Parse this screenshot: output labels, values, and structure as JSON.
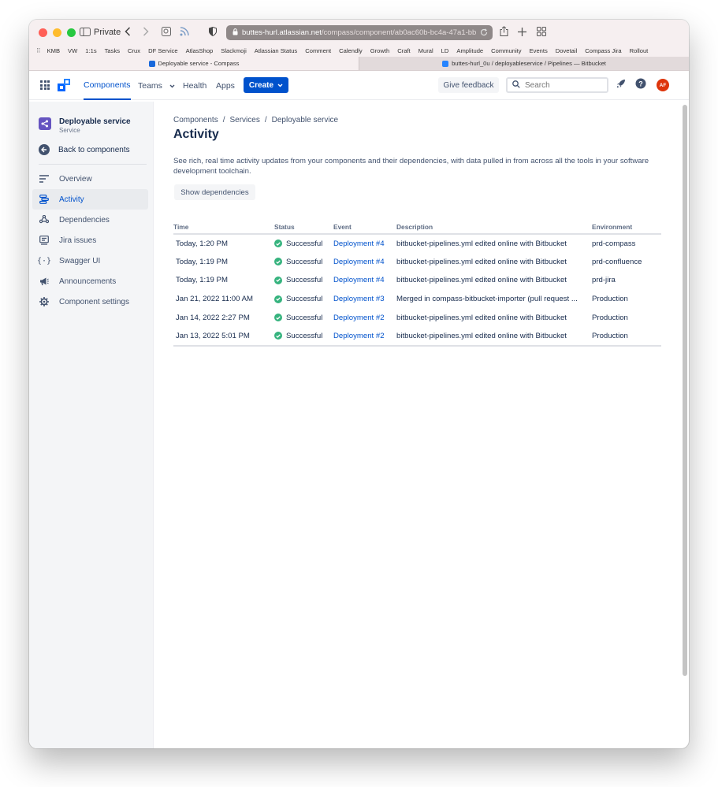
{
  "browser": {
    "private_label": "Private",
    "url_host": "buttes-hurl.atlassian.net",
    "url_path": "/compass/component/ab0ac60b-bc4a-47a1-bb",
    "bookmarks": [
      "KMB",
      "VW",
      "1:1s",
      "Tasks",
      "Crux",
      "DF Service",
      "AtlasShop",
      "Slackmoji",
      "Atlassian Status",
      "Comment",
      "Calendly",
      "Growth",
      "Craft",
      "Mural",
      "LD",
      "Amplitude",
      "Community",
      "Events",
      "Dovetail",
      "Compass Jira",
      "Rollout"
    ],
    "tabs": [
      {
        "title": "Deployable service - Compass",
        "active": true
      },
      {
        "title": "buttes-hurl_0u / deployableservice / Pipelines — Bitbucket",
        "active": false
      }
    ],
    "traffic_colors": [
      "#ff5f57",
      "#febc2e",
      "#28c840"
    ]
  },
  "header": {
    "nav": [
      "Components",
      "Teams",
      "Health",
      "Apps"
    ],
    "create_label": "Create",
    "feedback_label": "Give feedback",
    "search_placeholder": "Search",
    "avatar_initials": "AF",
    "accent": "#0052cc"
  },
  "sidebar": {
    "component_name": "Deployable service",
    "component_type": "Service",
    "back_label": "Back to components",
    "items": [
      {
        "label": "Overview",
        "icon": "overview-icon"
      },
      {
        "label": "Activity",
        "icon": "activity-icon",
        "active": true
      },
      {
        "label": "Dependencies",
        "icon": "dependencies-icon"
      },
      {
        "label": "Jira issues",
        "icon": "jira-issues-icon"
      },
      {
        "label": "Swagger UI",
        "icon": "swagger-icon"
      },
      {
        "label": "Announcements",
        "icon": "megaphone-icon"
      },
      {
        "label": "Component settings",
        "icon": "gear-icon"
      }
    ]
  },
  "main": {
    "breadcrumb": [
      "Components",
      "Services",
      "Deployable service"
    ],
    "title": "Activity",
    "description": "See rich, real time activity updates from your components and their dependencies, with data pulled in from across all the tools in your software development toolchain.",
    "show_deps_label": "Show dependencies",
    "table": {
      "columns": [
        "Time",
        "Status",
        "Event",
        "Description",
        "Environment"
      ],
      "rows": [
        {
          "time": "Today, 1:20 PM",
          "status": "Successful",
          "event": "Deployment #4",
          "description": "bitbucket-pipelines.yml edited online with Bitbucket",
          "environment": "prd-compass"
        },
        {
          "time": "Today, 1:19 PM",
          "status": "Successful",
          "event": "Deployment #4",
          "description": "bitbucket-pipelines.yml edited online with Bitbucket",
          "environment": "prd-confluence"
        },
        {
          "time": "Today, 1:19 PM",
          "status": "Successful",
          "event": "Deployment #4",
          "description": "bitbucket-pipelines.yml edited online with Bitbucket",
          "environment": "prd-jira"
        },
        {
          "time": "Jan 21, 2022 11:00 AM",
          "status": "Successful",
          "event": "Deployment #3",
          "description": "Merged in compass-bitbucket-importer (pull request ...",
          "environment": "Production"
        },
        {
          "time": "Jan 14, 2022 2:27 PM",
          "status": "Successful",
          "event": "Deployment #2",
          "description": "bitbucket-pipelines.yml edited online with Bitbucket",
          "environment": "Production"
        },
        {
          "time": "Jan 13, 2022 5:01 PM",
          "status": "Successful",
          "event": "Deployment #2",
          "description": "bitbucket-pipelines.yml edited online with Bitbucket",
          "environment": "Production"
        }
      ]
    }
  }
}
